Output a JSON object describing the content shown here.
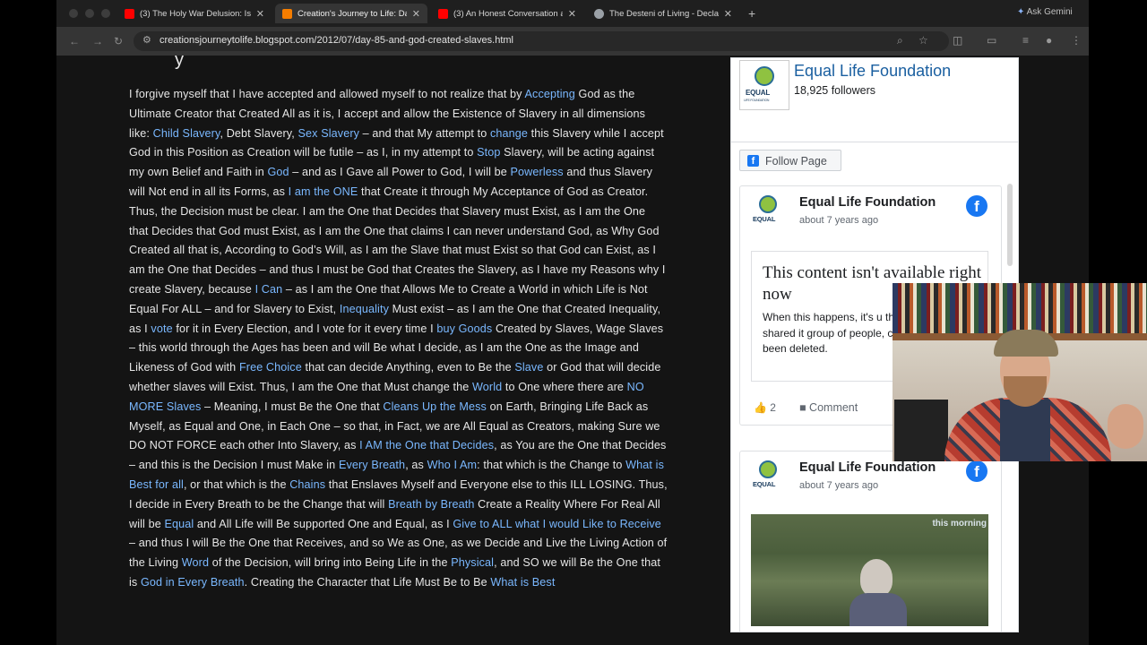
{
  "browser": {
    "tabs": [
      {
        "title": "(3) The Holy War Delusion: Is",
        "icon": "youtube-icon",
        "color": "#ff0000",
        "active": false
      },
      {
        "title": "Creation's Journey to Life: Da",
        "icon": "blogger-icon",
        "color": "#f57d00",
        "active": true
      },
      {
        "title": "(3) An Honest Conversation a",
        "icon": "youtube-icon",
        "color": "#ff0000",
        "active": false
      },
      {
        "title": "The Desteni of Living - Decla",
        "icon": "globe-icon",
        "color": "#9aa0a6",
        "active": false
      }
    ],
    "new_tab": "+",
    "ask_gemini": "Ask Gemini",
    "url": "creationsjourneytolife.blogspot.com/2012/07/day-85-and-god-created-slaves.html"
  },
  "article": {
    "segments": [
      {
        "t": "I forgive myself that I have accepted and allowed myself to not realize that by "
      },
      {
        "t": "Accepting",
        "link": true
      },
      {
        "t": " God as the Ultimate Creator that Created All as it is, I accept and allow the Existence of Slavery in all dimensions like: "
      },
      {
        "t": "Child Slavery",
        "link": true
      },
      {
        "t": ", Debt Slavery, "
      },
      {
        "t": "Sex Slavery",
        "link": true
      },
      {
        "t": " – and that My attempt to "
      },
      {
        "t": "change",
        "link": true
      },
      {
        "t": " this Slavery while I accept God in this Position as Creation will be futile – as I, in my attempt to "
      },
      {
        "t": "Stop",
        "link": true
      },
      {
        "t": " Slavery, will be acting against my own Belief and Faith in "
      },
      {
        "t": "God",
        "link": true
      },
      {
        "t": " – and as I Gave all Power to God, I will be "
      },
      {
        "t": "Powerless",
        "link": true
      },
      {
        "t": " and thus Slavery will Not end in all its Forms, as "
      },
      {
        "t": "I am the ONE",
        "link": true
      },
      {
        "t": " that Create it through My Acceptance of God as Creator. Thus, the Decision must be clear. I am the One that Decides that Slavery must Exist, as I am the One that Decides that God must Exist, as I am the One that claims I can never understand God, as Why God Created all that is, According to God’s Will, as I am the Slave that must Exist so that God can Exist, as I am the One that Decides – and thus I must be God that Creates the Slavery, as I have my Reasons why I create Slavery, because "
      },
      {
        "t": "I Can",
        "link": true
      },
      {
        "t": " – as I am the One that Allows Me to Create a World in which Life is Not Equal For ALL – and for Slavery to Exist, "
      },
      {
        "t": "Inequality",
        "link": true
      },
      {
        "t": " Must exist – as I am the One that Created Inequality, as I "
      },
      {
        "t": "vote",
        "link": true
      },
      {
        "t": " for it in Every Election, and I vote for it every time I "
      },
      {
        "t": "buy Goods",
        "link": true
      },
      {
        "t": " Created by Slaves, Wage Slaves – this world through the Ages has been and will Be what I decide, as I am the One as the Image and Likeness of God with "
      },
      {
        "t": "Free Choice",
        "link": true
      },
      {
        "t": " that can decide Anything, even to Be the "
      },
      {
        "t": "Slave",
        "link": true
      },
      {
        "t": " or God that will decide whether slaves will Exist. Thus, I am the One that Must change the "
      },
      {
        "t": "World",
        "link": true
      },
      {
        "t": " to One where there are "
      },
      {
        "t": "NO MORE Slaves",
        "link": true
      },
      {
        "t": " – Meaning, I must Be the One that "
      },
      {
        "t": "Cleans Up the Mess",
        "link": true
      },
      {
        "t": " on Earth, Bringing Life Back as Myself, as Equal and One, in Each One – so that, in Fact, we are All Equal as Creators, making Sure we DO NOT FORCE each other Into Slavery, as "
      },
      {
        "t": "I AM the One that Decides",
        "link": true
      },
      {
        "t": ", as You are the One that Decides – and this is the Decision I must Make in "
      },
      {
        "t": "Every Breath",
        "link": true
      },
      {
        "t": ", as "
      },
      {
        "t": "Who I Am",
        "link": true
      },
      {
        "t": ": that which is the Change to "
      },
      {
        "t": "What is Best for all",
        "link": true
      },
      {
        "t": ", or that which is the "
      },
      {
        "t": "Chains",
        "link": true
      },
      {
        "t": " that Enslaves Myself and Everyone else to this ILL LOSING. Thus, I decide in Every Breath to be the Change that will "
      },
      {
        "t": "Breath by Breath",
        "link": true
      },
      {
        "t": " Create a Reality Where For Real All will be "
      },
      {
        "t": "Equal",
        "link": true
      },
      {
        "t": " and All Life will Be supported One and Equal, as I "
      },
      {
        "t": "Give to ALL what I would Like to Receive",
        "link": true
      },
      {
        "t": " – and thus I will Be the One that Receives, and so We as One, as we Decide and Live the Living Action of the Living "
      },
      {
        "t": "Word",
        "link": true
      },
      {
        "t": " of the Decision, will bring into Being Life in the "
      },
      {
        "t": "Physical",
        "link": true
      },
      {
        "t": ", and SO we will Be the One that is "
      },
      {
        "t": "God in Every Breath",
        "link": true
      },
      {
        "t": ". Creating the Character that Life Must Be to Be "
      },
      {
        "t": "What is Best",
        "link": true
      }
    ]
  },
  "facebook": {
    "page_name": "Equal Life Foundation",
    "followers": "18,925 followers",
    "logo_text": "EQUAL",
    "logo_sub": "LIFE FOUNDATION",
    "follow_label": "Follow Page",
    "posts": [
      {
        "name": "Equal Life Foundation",
        "date": "about 7 years ago",
        "unavailable_title": "This content isn't available right now",
        "unavailable_body": "When this happens, it's u the owner only shared it group of people, changed or it's been deleted.",
        "likes": "2",
        "comment_label": "Comment"
      },
      {
        "name": "Equal Life Foundation",
        "date": "about 7 years ago",
        "watermark": "this morning"
      }
    ]
  }
}
